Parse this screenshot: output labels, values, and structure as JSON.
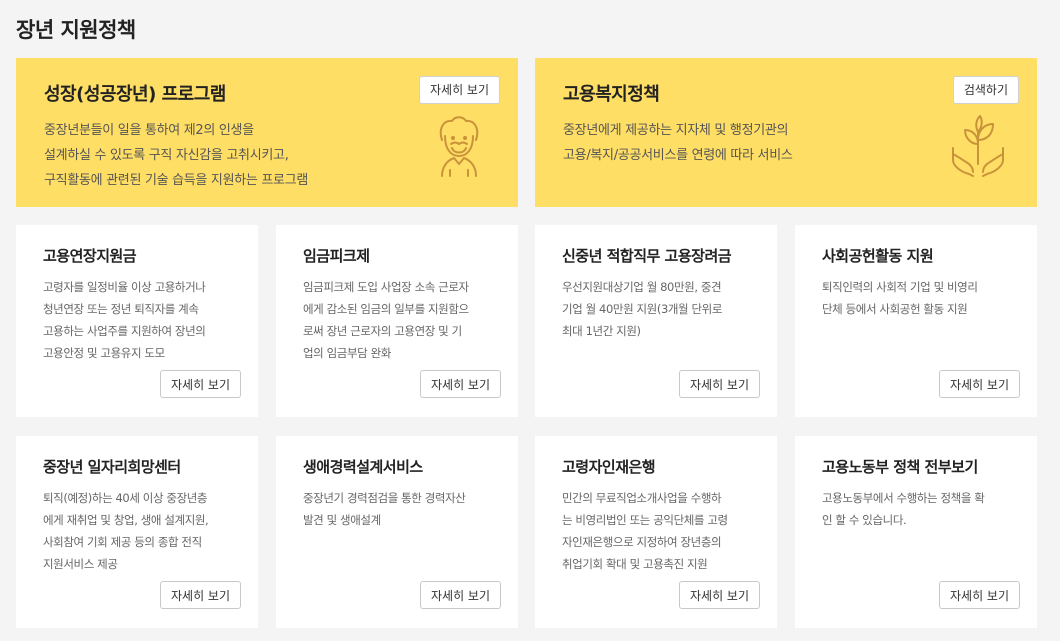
{
  "page": {
    "title": "장년 지원정책"
  },
  "heroes": [
    {
      "title": "성장(성공장년) 프로그램",
      "button": "자세히 보기",
      "desc": [
        "중장년분들이 일을 통하여 제2의 인생을",
        "설계하실 수 있도록 구직 자신감을 고취시키고,",
        "구직활동에 관련된 기술 습득을 지원하는 프로그램"
      ],
      "icon": "elderly-man-icon"
    },
    {
      "title": "고용복지정책",
      "button": "검색하기",
      "desc": [
        "중장년에게 제공하는 지자체 및 행정기관의",
        "고용/복지/공공서비스를 연령에 따라 서비스"
      ],
      "icon": "hands-plant-icon"
    }
  ],
  "cards": [
    {
      "title": "고용연장지원금",
      "desc": [
        "고령자를 일정비율 이상 고용하거나",
        "청년연장 또는 정년 퇴직자를 계속",
        "고용하는 사업주를 지원하여 장년의",
        "고용안정 및 고용유지 도모"
      ],
      "button": "자세히 보기"
    },
    {
      "title": "임금피크제",
      "desc": [
        "임금피크제 도입 사업장 소속 근로자",
        "에게 감소된 임금의 일부를 지원함으",
        "로써 장년 근로자의 고용연장 및 기",
        "업의 임금부담 완화"
      ],
      "button": "자세히 보기"
    },
    {
      "title": "신중년 적합직무 고용장려금",
      "desc": [
        "우선지원대상기업 월 80만원, 중견",
        "기업 월 40만원 지원(3개월 단위로",
        "최대 1년간 지원)"
      ],
      "button": "자세히 보기"
    },
    {
      "title": "사회공헌활동 지원",
      "desc": [
        "퇴직인력의 사회적 기업 및 비영리",
        "단체 등에서 사회공헌 활동 지원"
      ],
      "button": "자세히 보기"
    },
    {
      "title": "중장년 일자리희망센터",
      "desc": [
        "퇴직(예정)하는 40세 이상 중장년층",
        "에게 재취업 및 창업, 생애 설계지원,",
        "사회참여 기회 제공 등의 종합 전직",
        "지원서비스 제공"
      ],
      "button": "자세히 보기"
    },
    {
      "title": "생애경력설계서비스",
      "desc": [
        "중장년기 경력점검을 통한 경력자산",
        "발견 및 생애설계"
      ],
      "button": "자세히 보기"
    },
    {
      "title": "고령자인재은행",
      "desc": [
        "민간의 무료직업소개사업을 수행하",
        "는 비영리법인 또는 공익단체를 고령",
        "자인재은행으로 지정하여 장년층의",
        "취업기회 확대 및 고용촉진 지원"
      ],
      "button": "자세히 보기"
    },
    {
      "title": "고용노동부 정책 전부보기",
      "desc": [
        "고용노동부에서 수행하는 정책을 확",
        "인 할 수 있습니다."
      ],
      "button": "자세히 보기"
    }
  ],
  "colors": {
    "hero_bg": "#ffde66",
    "page_bg": "#f4f4f4",
    "icon_stroke": "#c9933a"
  }
}
